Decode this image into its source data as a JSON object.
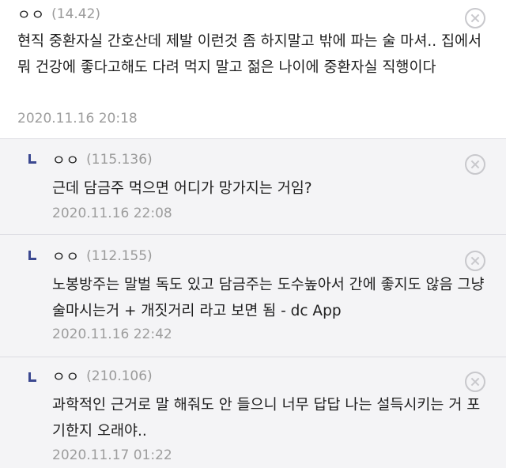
{
  "comments": [
    {
      "nick": "ㅇㅇ",
      "ip": "(14.42)",
      "text": "현직 중환자실 간호산데 제발 이런것 좀 하지말고 밖에 파는 술 마셔.. 집에서 뭐 건강에 좋다고해도 다려 먹지 말고 젊은 나이에 중환자실 직행이다",
      "timestamp": "2020.11.16 20:18",
      "delete_icon": "close-circle-icon"
    },
    {
      "nick": "ㅇㅇ",
      "ip": "(115.136)",
      "text": "근데 담금주 먹으면 어디가 망가지는 거임?",
      "timestamp": "2020.11.16 22:08",
      "delete_icon": "close-circle-icon"
    },
    {
      "nick": "ㅇㅇ",
      "ip": "(112.155)",
      "text": "노봉방주는 말벌 독도 있고 담금주는 도수높아서 간에 좋지도 않음 그냥 술마시는거 + 개짓거리 라고 보면 됨 - dc App",
      "timestamp": "2020.11.16 22:42",
      "delete_icon": "close-circle-icon"
    },
    {
      "nick": "ㅇㅇ",
      "ip": "(210.106)",
      "text": "과학적인 근거로 말 해줘도 안 들으니 너무 답답 나는 설득시키는 거 포기한지 오래야..",
      "timestamp": "2020.11.17 01:22",
      "delete_icon": "close-circle-icon"
    }
  ],
  "colors": {
    "reply_marker": "#3b4890",
    "timestamp": "#9d9d9d",
    "ip": "#9a9a9a"
  }
}
